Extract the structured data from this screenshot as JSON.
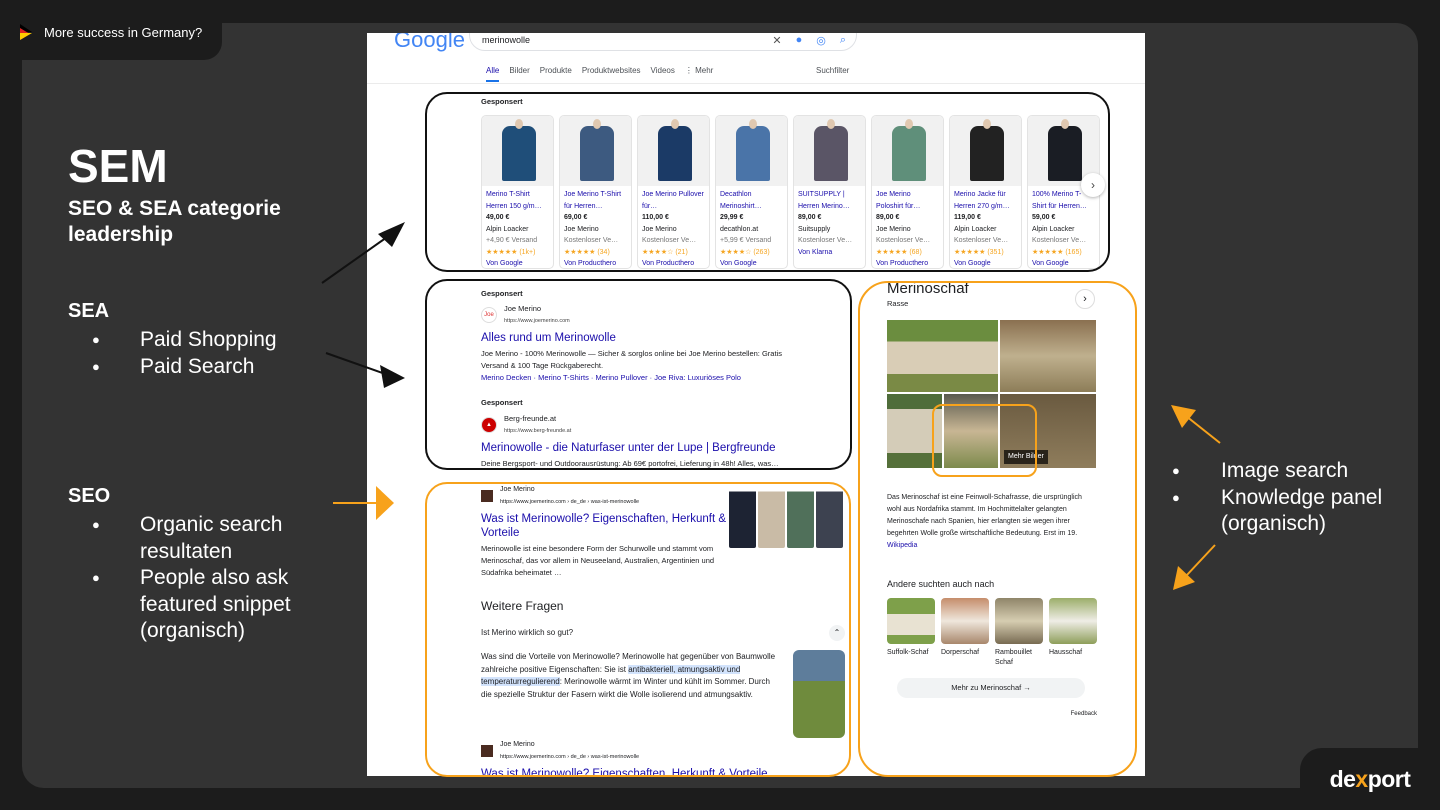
{
  "top_badge": "More success in Germany?",
  "heading": {
    "title": "SEM",
    "subtitle": "SEO & SEA categorie leadership"
  },
  "sea": {
    "title": "SEA",
    "items": [
      "Paid Shopping",
      "Paid Search"
    ]
  },
  "seo": {
    "title": "SEO",
    "items": [
      "Organic search resultaten",
      "People also ask featured snippet (organisch)"
    ]
  },
  "right_list": [
    "Image search",
    "Knowledge panel (organisch)"
  ],
  "logo": {
    "pre": "de",
    "x": "x",
    "post": "port"
  },
  "colors": {
    "accent": "#f7a21b",
    "panel": "#333333",
    "bg": "#1c1c1c"
  },
  "google": {
    "logo": "Google",
    "query": "merinowolle",
    "tabs": [
      "Alle",
      "Bilder",
      "Produkte",
      "Produktwebsites",
      "Videos",
      "⋮ Mehr"
    ],
    "filter": "Suchfilter",
    "sponsored": "Gesponsert",
    "products": [
      {
        "title": "Merino T-Shirt Herren 150 g/m…",
        "price": "49,00 €",
        "seller": "Alpin Loacker",
        "ship": "+4,90 € Versand",
        "rating": "★★★★★ (1k+)",
        "src": "Von Google",
        "color": "#1f4e79"
      },
      {
        "title": "Joe Merino T-Shirt für Herren…",
        "price": "69,00 €",
        "seller": "Joe Merino",
        "ship": "Kostenloser Ve…",
        "rating": "★★★★★ (34)",
        "src": "Von Producthero",
        "color": "#3d5a80"
      },
      {
        "title": "Joe Merino Pullover für…",
        "price": "110,00 €",
        "seller": "Joe Merino",
        "ship": "Kostenloser Ve…",
        "rating": "★★★★☆ (21)",
        "src": "Von Producthero",
        "color": "#1b3a66"
      },
      {
        "title": "Decathlon Merinoshirt…",
        "price": "29,99 €",
        "seller": "decathlon.at",
        "ship": "+5,99 € Versand",
        "rating": "★★★★☆ (263)",
        "src": "Von Google",
        "color": "#4a74a8"
      },
      {
        "title": "SUITSUPPLY | Herren Merino…",
        "price": "89,00 €",
        "seller": "Suitsupply",
        "ship": "Kostenloser Ve…",
        "rating": "",
        "src": "Von Klarna",
        "color": "#5a5566"
      },
      {
        "title": "Joe Merino Poloshirt für…",
        "price": "89,00 €",
        "seller": "Joe Merino",
        "ship": "Kostenloser Ve…",
        "rating": "★★★★★ (68)",
        "src": "Von Producthero",
        "color": "#5f8f7a"
      },
      {
        "title": "Merino Jacke für Herren 270 g/m…",
        "price": "119,00 €",
        "seller": "Alpin Loacker",
        "ship": "Kostenloser Ve…",
        "rating": "★★★★★ (351)",
        "src": "Von Google",
        "color": "#222222"
      },
      {
        "title": "100% Merino T-Shirt für Herren…",
        "price": "59,00 €",
        "seller": "Alpin Loacker",
        "ship": "Kostenloser Ve…",
        "rating": "★★★★★ (165)",
        "src": "Von Google",
        "color": "#1a1d24"
      }
    ],
    "ads": [
      {
        "fav": "Joe",
        "site": "Joe Merino",
        "url": "https://www.joemerino.com",
        "title": "Alles rund um Merinowolle",
        "desc": "Joe Merino - 100% Merinowolle — Sicher & sorglos online bei Joe Merino bestellen: Gratis Versand & 100 Tage Rückgaberecht.",
        "links": "Merino Decken · Merino T-Shirts · Merino Pullover · Joe Riva: Luxuriöses Polo"
      },
      {
        "fav": "▲",
        "site": "Berg-freunde.at",
        "url": "https://www.berg-freunde.at",
        "title": "Merinowolle - die Naturfaser unter der Lupe | Bergfreunde",
        "desc": "Deine Bergsport- und Outdoorausrüstung: Ab 69€ portofrei, Lieferung in 48h! Alles, was…"
      }
    ],
    "organic": {
      "site": "Joe Merino",
      "url": "https://www.joemerino.com › de_de › was-ist-merinowolle",
      "title": "Was ist Merinowolle? Eigenschaften, Herkunft & Vorteile",
      "desc": "Merinowolle ist eine besondere Form der Schurwolle und stammt vom Merinoschaf, das vor allem in Neuseeland, Australien, Argentinien und Südafrika beheimatet …"
    },
    "paa": {
      "title": "Weitere Fragen",
      "question": "Ist Merino wirklich so gut?",
      "answer_pre": "Was sind die Vorteile von Merinowolle? Merinowolle hat gegenüber von Baumwolle zahlreiche positive Eigenschaften: Sie ist ",
      "answer_hl": "antibakteriell, atmungsaktiv und temperaturregulierend",
      "answer_post": ": Merinowolle wärmt im Winter und kühlt im Sommer. Durch die spezielle Struktur der Fasern wirkt die Wolle isolierend und atmungsaktiv."
    },
    "organic2": {
      "site": "Joe Merino",
      "url": "https://www.joemerino.com › de_de › was-ist-merinowolle",
      "title": "Was ist Merinowolle? Eigenschaften, Herkunft & Vorteile"
    },
    "kp": {
      "name": "Merinoschaf",
      "type": "Rasse",
      "more_images": "Mehr Bilder",
      "desc": "Das Merinoschaf ist eine Feinwoll-Schafrasse, die ursprünglich wohl aus Nordafrika stammt. Im Hochmittelalter gelangten Merinoschafe nach Spanien, hier erlangten sie wegen ihrer begehrten Wolle große wirtschaftliche Bedeutung. Erst im 19.",
      "desc_link": "Wikipedia",
      "related_title": "Andere suchten auch nach",
      "related": [
        "Suffolk-Schaf",
        "Dorperschaf",
        "Rambouillet Schaf",
        "Hausschaf"
      ],
      "more_btn": "Mehr zu Merinoschaf →",
      "feedback": "Feedback"
    }
  }
}
